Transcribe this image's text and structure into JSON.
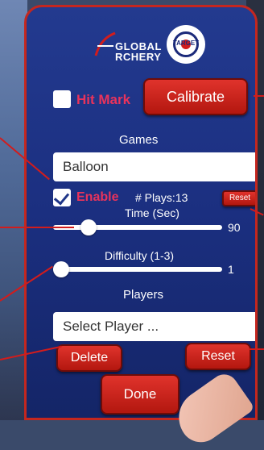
{
  "logo": {
    "line1": "GLOBAL",
    "line2": "RCHERY",
    "badge": "TARGET"
  },
  "hit_mark": {
    "label": "Hit Mark",
    "checked": false
  },
  "calibrate_button": "Calibrate",
  "games": {
    "heading": "Games",
    "selected": "Balloon",
    "enable_label": "Enable",
    "enable_checked": true,
    "plays_label": "# Plays:",
    "plays_value": "13",
    "reset_small": "Reset"
  },
  "time": {
    "label": "Time (Sec)",
    "value": "90",
    "fraction": 0.18
  },
  "difficulty": {
    "label": "Difficulty (1-3)",
    "value": "1",
    "fraction": 0.0
  },
  "players": {
    "heading": "Players",
    "selected": "Select Player ...",
    "delete": "Delete",
    "reset": "Reset"
  },
  "done_button": "Done",
  "colors": {
    "accent_red": "#d9231b",
    "panel_blue": "#1f3688",
    "label_red": "#e8335c"
  }
}
